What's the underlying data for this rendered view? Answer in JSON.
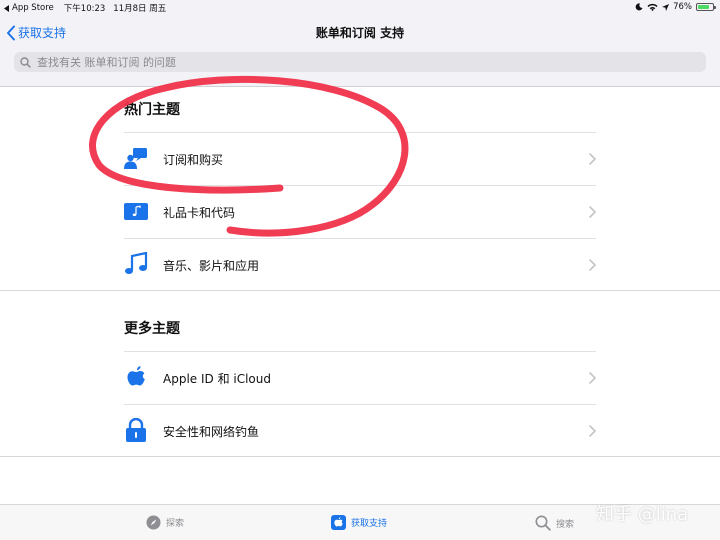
{
  "status_bar": {
    "back_app": "App Store",
    "time": "下午10:23",
    "date": "11月8日 周五",
    "battery": "76%"
  },
  "nav": {
    "back_label": "获取支持",
    "title": "账单和订阅 支持"
  },
  "search": {
    "placeholder": "查找有关 账单和订阅 的问题"
  },
  "sections": {
    "popular": {
      "title": "热门主题",
      "items": [
        {
          "label": "订阅和购买",
          "icon": "person-chat-icon"
        },
        {
          "label": "礼品卡和代码",
          "icon": "gift-card-icon"
        },
        {
          "label": "音乐、影片和应用",
          "icon": "music-note-icon"
        }
      ]
    },
    "more": {
      "title": "更多主题",
      "items": [
        {
          "label": "Apple ID 和 iCloud",
          "icon": "apple-icon"
        },
        {
          "label": "安全性和网络钓鱼",
          "icon": "lock-icon"
        }
      ]
    }
  },
  "tabbar": {
    "tabs": [
      {
        "label": "探索",
        "icon": "compass-icon",
        "active": false
      },
      {
        "label": "获取支持",
        "icon": "apple-support-icon",
        "active": true
      },
      {
        "label": "搜索",
        "icon": "search-icon",
        "active": false
      }
    ]
  },
  "watermark": "知乎 @lina",
  "colors": {
    "accent": "#1a73e8",
    "annotation": "#f0334b",
    "background": "#f2f2f7"
  }
}
